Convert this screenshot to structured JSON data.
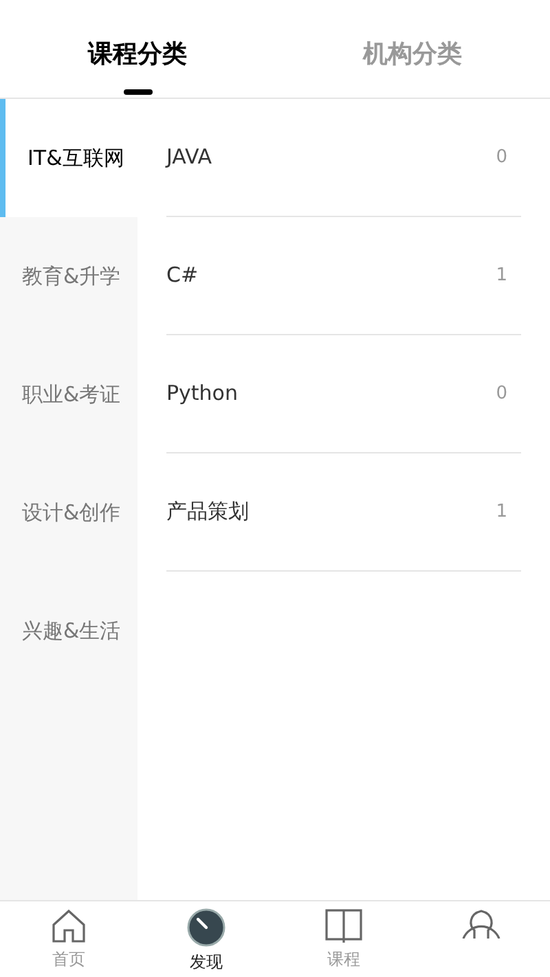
{
  "tabs": [
    {
      "label": "课程分类",
      "selected": true
    },
    {
      "label": "机构分类",
      "selected": false
    }
  ],
  "sidebar": {
    "items": [
      {
        "label": "IT&互联网",
        "selected": true
      },
      {
        "label": "教育&升学",
        "selected": false
      },
      {
        "label": "职业&考证",
        "selected": false
      },
      {
        "label": "设计&创作",
        "selected": false
      },
      {
        "label": "兴趣&生活",
        "selected": false
      }
    ]
  },
  "list": {
    "rows": [
      {
        "name": "JAVA",
        "count": "0"
      },
      {
        "name": "C#",
        "count": "1"
      },
      {
        "name": "Python",
        "count": "0"
      },
      {
        "name": "产品策划",
        "count": "1"
      }
    ]
  },
  "bottom_nav": [
    {
      "kind": "home",
      "label": "首页",
      "selected": false
    },
    {
      "kind": "discover",
      "label": "发现",
      "selected": true
    },
    {
      "kind": "book",
      "label": "课程",
      "selected": false
    },
    {
      "kind": "person",
      "selected": false
    }
  ]
}
